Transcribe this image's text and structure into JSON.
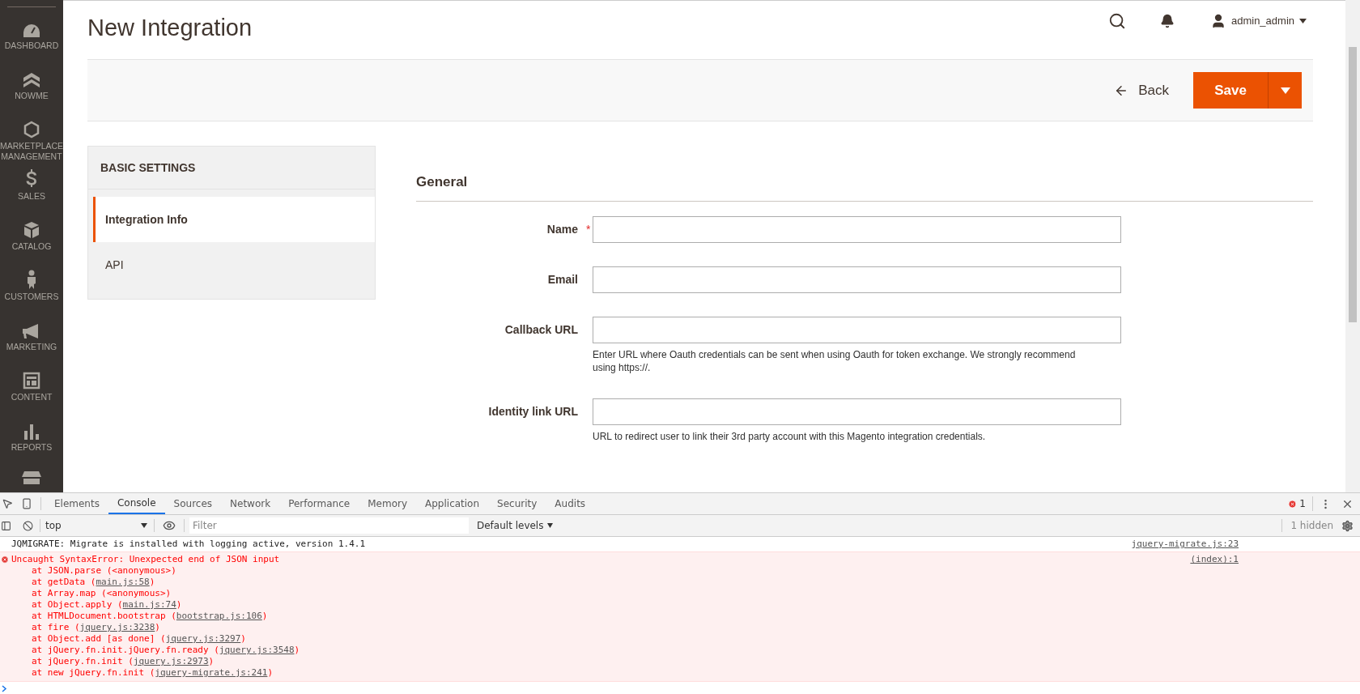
{
  "sidebar": {
    "items": [
      {
        "label": "DASHBOARD"
      },
      {
        "label": "NOWME"
      },
      {
        "label": "MARKETPLACE MANAGEMENT"
      },
      {
        "label": "SALES"
      },
      {
        "label": "CATALOG"
      },
      {
        "label": "CUSTOMERS"
      },
      {
        "label": "MARKETING"
      },
      {
        "label": "CONTENT"
      },
      {
        "label": "REPORTS"
      }
    ]
  },
  "header": {
    "title": "New Integration",
    "user": "admin_admin"
  },
  "actions": {
    "back": "Back",
    "save": "Save"
  },
  "settings_panel": {
    "title": "BASIC SETTINGS",
    "tabs": [
      {
        "label": "Integration Info",
        "selected": true
      },
      {
        "label": "API",
        "selected": false
      }
    ]
  },
  "form": {
    "section": "General",
    "fields": [
      {
        "label": "Name",
        "required_mark": "*"
      },
      {
        "label": "Email"
      },
      {
        "label": "Callback URL",
        "note": "Enter URL where Oauth credentials can be sent when using Oauth for token exchange. We strongly recommend using https://."
      },
      {
        "label": "Identity link URL",
        "note": "URL to redirect user to link their 3rd party account with this Magento integration credentials."
      }
    ]
  },
  "devtools": {
    "tabs": [
      {
        "label": "Elements",
        "selected": false
      },
      {
        "label": "Console",
        "selected": true
      },
      {
        "label": "Sources",
        "selected": false
      },
      {
        "label": "Network",
        "selected": false
      },
      {
        "label": "Performance",
        "selected": false
      },
      {
        "label": "Memory",
        "selected": false
      },
      {
        "label": "Application",
        "selected": false
      },
      {
        "label": "Security",
        "selected": false
      },
      {
        "label": "Audits",
        "selected": false
      }
    ],
    "error_count": "1",
    "context": "top",
    "filter_placeholder": "Filter",
    "levels": "Default levels",
    "hidden": "1 hidden",
    "messages": [
      {
        "kind": "log",
        "text": "JQMIGRATE: Migrate is installed with logging active, version 1.4.1",
        "source": "jquery-migrate.js:23"
      },
      {
        "kind": "error",
        "text": "Uncaught SyntaxError: Unexpected end of JSON input",
        "source": "(index):1",
        "stack": [
          {
            "text": "at JSON.parse (<anonymous>)"
          },
          {
            "text": "at getData (",
            "link": "main.js:58",
            "end": ")"
          },
          {
            "text": "at Array.map (<anonymous>)"
          },
          {
            "text": "at Object.apply (",
            "link": "main.js:74",
            "end": ")"
          },
          {
            "text": "at HTMLDocument.bootstrap (",
            "link": "bootstrap.js:106",
            "end": ")"
          },
          {
            "text": "at fire (",
            "link": "jquery.js:3238",
            "end": ")"
          },
          {
            "text": "at Object.add [as done] (",
            "link": "jquery.js:3297",
            "end": ")"
          },
          {
            "text": "at jQuery.fn.init.jQuery.fn.ready (",
            "link": "jquery.js:3548",
            "end": ")"
          },
          {
            "text": "at jQuery.fn.init (",
            "link": "jquery.js:2973",
            "end": ")"
          },
          {
            "text": "at new jQuery.fn.init (",
            "link": "jquery-migrate.js:241",
            "end": ")"
          }
        ]
      }
    ]
  }
}
